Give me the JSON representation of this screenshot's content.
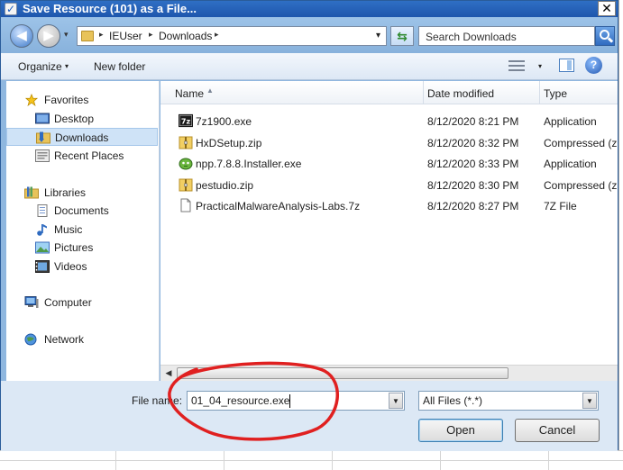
{
  "window": {
    "title": "Save Resource (101) as a File...",
    "close_glyph": "✕"
  },
  "address_bar": {
    "path": [
      "IEUser",
      "Downloads"
    ],
    "separator": "▸",
    "dropdown_glyph": "▾"
  },
  "search": {
    "placeholder": "Search Downloads"
  },
  "toolbar": {
    "organize_label": "Organize",
    "new_folder_label": "New folder",
    "help_glyph": "?"
  },
  "nav": {
    "favorites_label": "Favorites",
    "desktop_label": "Desktop",
    "downloads_label": "Downloads",
    "recent_places_label": "Recent Places",
    "libraries_label": "Libraries",
    "documents_label": "Documents",
    "music_label": "Music",
    "pictures_label": "Pictures",
    "videos_label": "Videos",
    "computer_label": "Computer",
    "network_label": "Network",
    "selected": "Downloads"
  },
  "columns": {
    "name": "Name",
    "date_modified": "Date modified",
    "type": "Type"
  },
  "files": [
    {
      "name": "7z1900.exe",
      "date": "8/12/2020 8:21 PM",
      "type": "Application",
      "icon": "7z-icon"
    },
    {
      "name": "HxDSetup.zip",
      "date": "8/12/2020 8:32 PM",
      "type": "Compressed (zip",
      "icon": "zip-folder-icon"
    },
    {
      "name": "npp.7.8.8.Installer.exe",
      "date": "8/12/2020 8:33 PM",
      "type": "Application",
      "icon": "notepad-plus-icon"
    },
    {
      "name": "pestudio.zip",
      "date": "8/12/2020 8:30 PM",
      "type": "Compressed (zip",
      "icon": "zip-folder-icon"
    },
    {
      "name": "PracticalMalwareAnalysis-Labs.7z",
      "date": "8/12/2020 8:27 PM",
      "type": "7Z File",
      "icon": "file-icon"
    }
  ],
  "form": {
    "file_name_label": "File name:",
    "file_name_value": "01_04_resource.exe",
    "file_type_value": "All Files (*.*)",
    "open_label": "Open",
    "cancel_label": "Cancel"
  },
  "colors": {
    "annotation_stroke": "#e02020",
    "accent": "#1e56ad"
  }
}
